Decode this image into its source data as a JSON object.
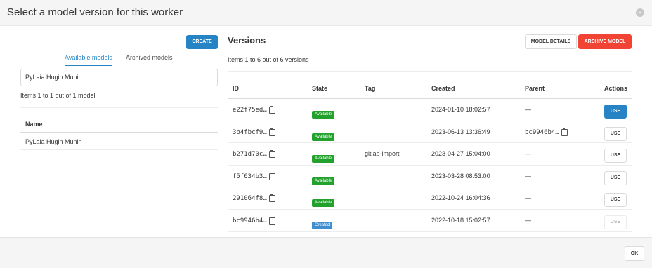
{
  "header": {
    "title": "Select a model version for this worker",
    "close_icon": "×"
  },
  "left": {
    "create_label": "CREATE",
    "tabs": [
      {
        "label": "Available models"
      },
      {
        "label": "Archived models"
      }
    ],
    "search_value": "PyLaia Hugin Munin",
    "count_text": "Items 1 to 1 out of 1 model",
    "table_header": "Name",
    "rows": [
      {
        "name": "PyLaia Hugin Munin"
      }
    ]
  },
  "right": {
    "title": "Versions",
    "model_details_label": "MODEL DETAILS",
    "archive_model_label": "ARCHIVE MODEL",
    "count_text": "Items 1 to 6 out of 6 versions",
    "columns": {
      "id": "ID",
      "state": "State",
      "tag": "Tag",
      "created": "Created",
      "parent": "Parent",
      "actions": "Actions"
    },
    "rows": [
      {
        "id": "e22f75ed…",
        "state": "Available",
        "tag": "",
        "created": "2024-01-10 18:02:57",
        "parent": "—",
        "action": "USE"
      },
      {
        "id": "3b4fbcf9…",
        "state": "Available",
        "tag": "",
        "created": "2023-06-13 13:36:49",
        "parent": "bc9946b4…",
        "action": "USE"
      },
      {
        "id": "b271d70c…",
        "state": "Available",
        "tag": "gitlab-import",
        "created": "2023-04-27 15:04:00",
        "parent": "—",
        "action": "USE"
      },
      {
        "id": "f5f634b3…",
        "state": "Available",
        "tag": "",
        "created": "2023-03-28 08:53:00",
        "parent": "—",
        "action": "USE"
      },
      {
        "id": "291064f8…",
        "state": "Available",
        "tag": "",
        "created": "2022-10-24 16:04:36",
        "parent": "—",
        "action": "USE"
      },
      {
        "id": "bc9946b4…",
        "state": "Created",
        "tag": "",
        "created": "2022-10-18 15:02:57",
        "parent": "—",
        "action": "USE"
      }
    ]
  },
  "footer": {
    "ok_label": "OK"
  },
  "colors": {
    "primary": "#2684c5",
    "danger": "#f14435",
    "success": "#23a12d",
    "info": "#3e8ed0"
  }
}
